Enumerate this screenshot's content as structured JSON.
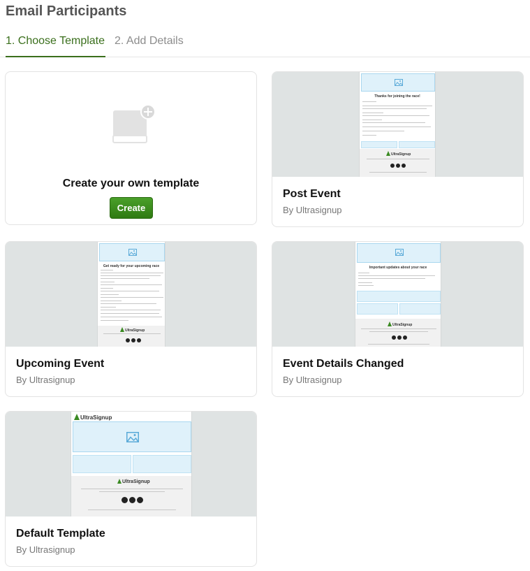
{
  "page": {
    "title": "Email Participants"
  },
  "steps": [
    {
      "label": "1. Choose Template"
    },
    {
      "label": "2. Add Details"
    }
  ],
  "create_card": {
    "title": "Create your own template",
    "button_label": "Create"
  },
  "templates": [
    {
      "name": "Post Event",
      "author": "By Ultrasignup",
      "preview_heading": "Thanks for joining the race!"
    },
    {
      "name": "Upcoming Event",
      "author": "By Ultrasignup",
      "preview_heading": "Get ready for your upcoming race"
    },
    {
      "name": "Event Details Changed",
      "author": "By Ultrasignup",
      "preview_heading": "Important updates about your race"
    },
    {
      "name": "Default Template",
      "author": "By Ultrasignup",
      "preview_logo": "UltraSignup"
    }
  ],
  "preview_footer_logo": "UltraSignup",
  "colors": {
    "accent": "#3a6f1c",
    "button": "#3a8a1e",
    "thumb_bg": "#dfe3e3",
    "image_placeholder": "#dff1fa"
  }
}
